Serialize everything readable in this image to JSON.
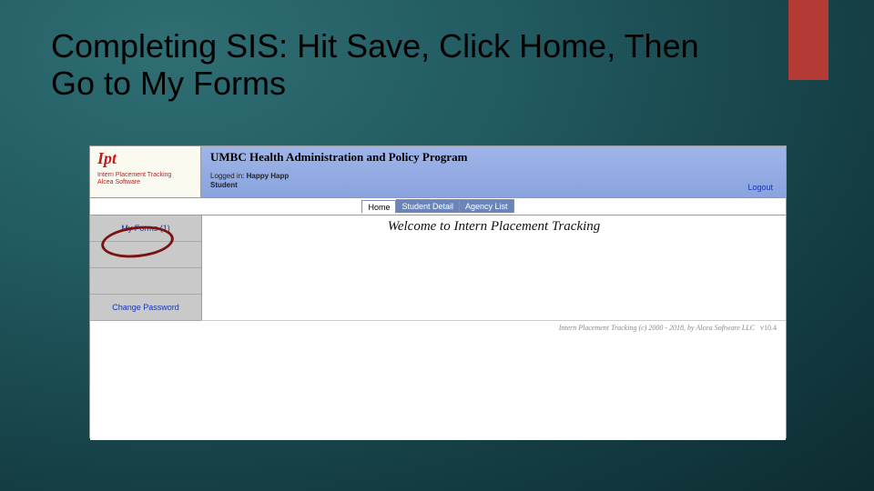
{
  "slide": {
    "title": "Completing SIS: Hit Save, Click Home, Then Go to My Forms"
  },
  "screenshot": {
    "logo": {
      "brand": "Ipt",
      "line1": "Intern Placement Tracking",
      "line2": "Alcea Software"
    },
    "banner": {
      "program": "UMBC Health Administration and Policy Program",
      "logged_in_label": "Logged in:",
      "logged_in_name": "Happy Happ",
      "role": "Student",
      "logout": "Logout"
    },
    "tabs": {
      "home": "Home",
      "student_detail": "Student Detail",
      "agency_list": "Agency List"
    },
    "sidebar": {
      "my_forms": "My Forms (1)",
      "change_password": "Change Password"
    },
    "main": {
      "welcome": "Welcome to Intern Placement Tracking"
    },
    "footer": {
      "copyright": "Intern Placement Tracking (c) 2000 - 2018,   by Alcea Software LLC",
      "version": "v10.4"
    }
  }
}
